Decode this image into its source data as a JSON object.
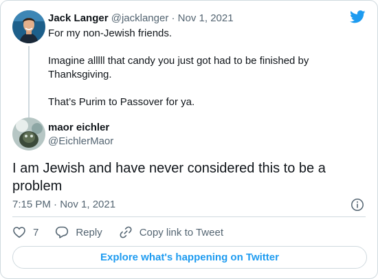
{
  "parent_tweet": {
    "name": "Jack Langer",
    "handle": "@jacklanger",
    "separator": " · ",
    "date": "Nov 1, 2021",
    "paragraphs": [
      "For my non-Jewish friends.",
      "Imagine alllll that candy you just got had to be finished by Thanksgiving.",
      "That’s Purim to Passover for ya."
    ]
  },
  "main_tweet": {
    "name": "maor eichler",
    "handle": "@EichlerMaor",
    "text": "I am Jewish and have never considered this to be a problem",
    "timestamp": "7:15 PM · Nov 1, 2021"
  },
  "actions": {
    "like_count": "7",
    "reply_label": "Reply",
    "copy_link_label": "Copy link to Tweet"
  },
  "footer": {
    "explore_label": "Explore what's happening on Twitter"
  },
  "colors": {
    "brand": "#1d9bf0",
    "secondary_text": "#536471",
    "border": "#cfd9de"
  },
  "icons": [
    "twitter-bird-icon",
    "info-icon",
    "heart-icon",
    "reply-icon",
    "link-icon"
  ]
}
